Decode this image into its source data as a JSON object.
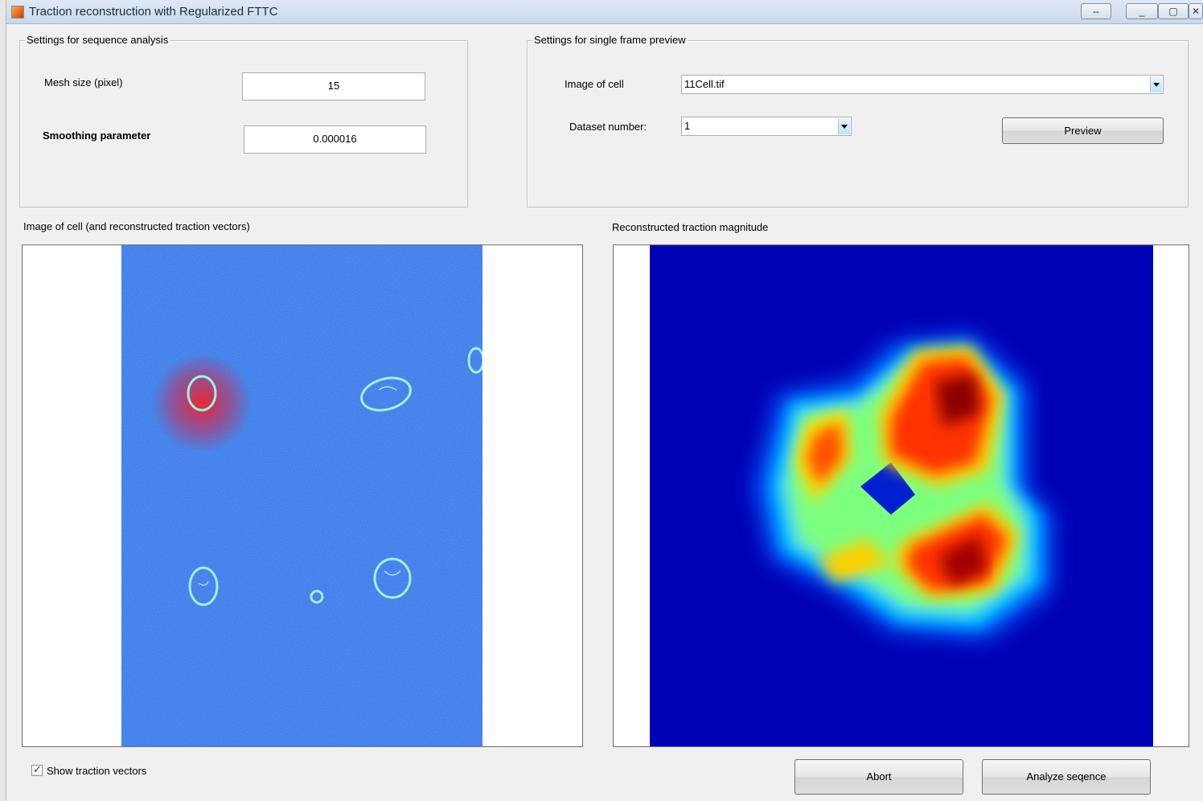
{
  "window": {
    "title": "Traction reconstruction with Regularized FTTC",
    "controls": {
      "resize": "⇔",
      "minimize": "_",
      "maximize": "▢",
      "close": "✕"
    }
  },
  "sequence_settings": {
    "title": "Settings for sequence analysis",
    "mesh_label": "Mesh size (pixel)",
    "mesh_value": "15",
    "smoothing_label": "Smoothing parameter",
    "smoothing_value": "0.000016"
  },
  "preview_settings": {
    "title": "Settings for single frame preview",
    "image_label": "Image of cell",
    "image_value": "11Cell.tif",
    "dataset_label": "Dataset number:",
    "dataset_value": "1",
    "preview_button": "Preview"
  },
  "left_axes": {
    "title": "Image of cell (and reconstructed traction vectors)"
  },
  "right_axes": {
    "title": "Reconstructed traction magnitude"
  },
  "footer": {
    "checkbox_label": "Show traction vectors",
    "checkbox_checked": true,
    "abort_button": "Abort",
    "analyze_button": "Analyze seqence"
  },
  "icons": {
    "app": "matlab-icon"
  },
  "colors": {
    "cell_bg": "#2d6ee6",
    "map_low": "#00008f",
    "map_high": "#7f0000"
  }
}
